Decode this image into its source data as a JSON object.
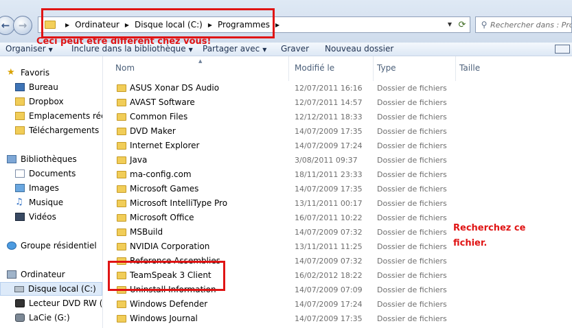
{
  "breadcrumb": [
    "Ordinateur",
    "Disque local (C:)",
    "Programmes"
  ],
  "search": {
    "placeholder": "Rechercher dans : Programmes"
  },
  "toolbar": {
    "organize": "Organiser",
    "include_library": "Inclure dans la bibliothèque",
    "share_with": "Partager avec",
    "burn": "Graver",
    "new_folder": "Nouveau dossier"
  },
  "sidebar": {
    "favorites_title": "Favoris",
    "favorites": [
      "Bureau",
      "Dropbox",
      "Emplacements récents",
      "Téléchargements"
    ],
    "libraries_title": "Bibliothèques",
    "libraries": [
      "Documents",
      "Images",
      "Musique",
      "Vidéos"
    ],
    "homegroup": "Groupe résidentiel",
    "computer_title": "Ordinateur",
    "drives": [
      "Disque local (C:)",
      "Lecteur DVD RW (D:)",
      "LaCie (G:)"
    ]
  },
  "columns": {
    "name": "Nom",
    "modified": "Modifié le",
    "type": "Type",
    "size": "Taille"
  },
  "files": [
    {
      "name": "ASUS Xonar DS Audio",
      "date": "12/07/2011 16:16",
      "type": "Dossier de fichiers"
    },
    {
      "name": "AVAST Software",
      "date": "12/07/2011 14:57",
      "type": "Dossier de fichiers"
    },
    {
      "name": "Common Files",
      "date": "12/12/2011 18:33",
      "type": "Dossier de fichiers"
    },
    {
      "name": "DVD Maker",
      "date": "14/07/2009 17:35",
      "type": "Dossier de fichiers"
    },
    {
      "name": "Internet Explorer",
      "date": "14/07/2009 17:24",
      "type": "Dossier de fichiers"
    },
    {
      "name": "Java",
      "date": "3/08/2011 09:37",
      "type": "Dossier de fichiers"
    },
    {
      "name": "ma-config.com",
      "date": "18/11/2011 23:33",
      "type": "Dossier de fichiers"
    },
    {
      "name": "Microsoft Games",
      "date": "14/07/2009 17:35",
      "type": "Dossier de fichiers"
    },
    {
      "name": "Microsoft IntelliType Pro",
      "date": "13/11/2011 00:17",
      "type": "Dossier de fichiers"
    },
    {
      "name": "Microsoft Office",
      "date": "16/07/2011 10:22",
      "type": "Dossier de fichiers"
    },
    {
      "name": "MSBuild",
      "date": "14/07/2009 07:32",
      "type": "Dossier de fichiers"
    },
    {
      "name": "NVIDIA Corporation",
      "date": "13/11/2011 11:25",
      "type": "Dossier de fichiers"
    },
    {
      "name": "Reference Assemblies",
      "date": "14/07/2009 07:32",
      "type": "Dossier de fichiers"
    },
    {
      "name": "TeamSpeak 3 Client",
      "date": "16/02/2012 18:22",
      "type": "Dossier de fichiers"
    },
    {
      "name": "Uninstall Information",
      "date": "14/07/2009 07:09",
      "type": "Dossier de fichiers"
    },
    {
      "name": "Windows Defender",
      "date": "14/07/2009 17:24",
      "type": "Dossier de fichiers"
    },
    {
      "name": "Windows Journal",
      "date": "14/07/2009 17:35",
      "type": "Dossier de fichiers"
    }
  ],
  "annotations": {
    "path_note": "Ceci peut etre different chez vous!",
    "target_note": "Recherchez ce fichier."
  },
  "colors": {
    "annotation": "#e01414",
    "selection": "#ddeaf9",
    "folder": "#f1cd58"
  }
}
